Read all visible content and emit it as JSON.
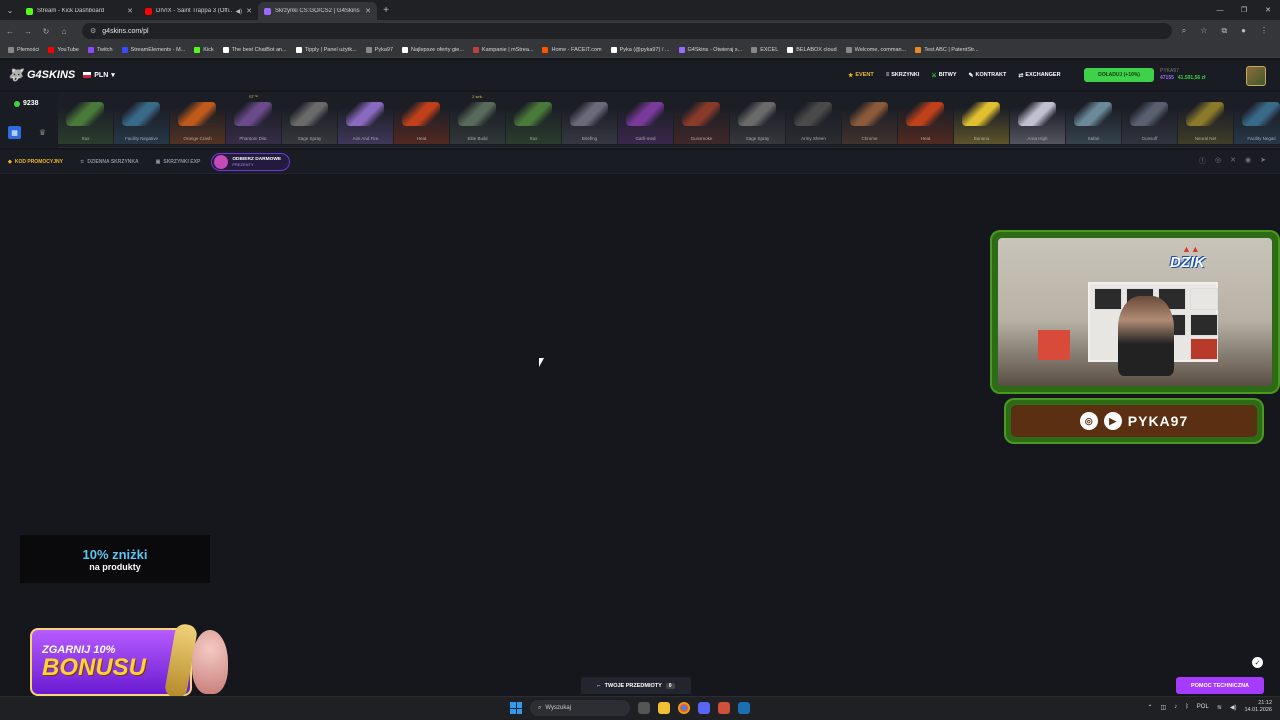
{
  "browser": {
    "tabs": [
      {
        "title": "Stream - Kick Dashboard",
        "icon_color": "#53fc18",
        "active": false
      },
      {
        "title": "DIVIX - Saint Trappa 3 (Offi...",
        "icon_color": "#ff0000",
        "active": false,
        "audio": true
      },
      {
        "title": "Skrzynki CS:GO/CS2 | G4Skins ...",
        "icon_color": "#9b6bff",
        "active": true
      }
    ],
    "new_tab": "+",
    "url": "g4skins.com/pl",
    "bookmarks": [
      {
        "label": "Płemości",
        "color": "#888"
      },
      {
        "label": "YouTube",
        "color": "#ff0000"
      },
      {
        "label": "Twitch",
        "color": "#9146ff"
      },
      {
        "label": "StreamElements - M...",
        "color": "#3a4bff"
      },
      {
        "label": "Kick",
        "color": "#53fc18"
      },
      {
        "label": "The best ChatBot an...",
        "color": "#ffffff"
      },
      {
        "label": "Tipply | Panel użytk...",
        "color": "#ffffff"
      },
      {
        "label": "Pyka97",
        "color": "#888"
      },
      {
        "label": "Najlepsze oferty gie...",
        "color": "#ffffff"
      },
      {
        "label": "Kampanie | mStrea...",
        "color": "#c04040"
      },
      {
        "label": "Home - FACEIT.com",
        "color": "#ff5500"
      },
      {
        "label": "Pyka (@pyka97) / ...",
        "color": "#ffffff"
      },
      {
        "label": "G4Skins - Otwieraj s...",
        "color": "#9b6bff"
      },
      {
        "label": "EXCEL",
        "color": "#888"
      },
      {
        "label": "BELABOX cloud",
        "color": "#ffffff"
      },
      {
        "label": "Welcome, comman...",
        "color": "#888"
      },
      {
        "label": "Test ABC | PatentStr...",
        "color": "#e88a2a"
      }
    ]
  },
  "site": {
    "logo": "G4SKINS",
    "currency": "PLN",
    "nav": [
      {
        "label": "EVENT",
        "icon": "star-icon",
        "glyph": "★"
      },
      {
        "label": "SKRZYNKI",
        "icon": "menu-icon",
        "glyph": "≡"
      },
      {
        "label": "BITWY",
        "icon": "battle-icon",
        "glyph": "⚔"
      },
      {
        "label": "KONTRAKT",
        "icon": "contract-icon",
        "glyph": "✎"
      },
      {
        "label": "EXCHANGER",
        "icon": "exchange-icon",
        "glyph": "⇄"
      }
    ],
    "deposit_label": "DOŁADUJ (+10%)",
    "balance_label": "PYKA97",
    "points": "47155",
    "balance": "41.591,56 zł"
  },
  "feed": {
    "online": "9238",
    "drops": [
      {
        "name": "Sus",
        "color": "#4a7a3a",
        "tag": ""
      },
      {
        "name": "Facility Negative",
        "color": "#3a6a8a",
        "tag": ""
      },
      {
        "name": "Orange Crash",
        "color": "#c05a1a",
        "tag": ""
      },
      {
        "name": "Phantom Disr.",
        "color": "#6a4a8a",
        "tag": "ST™"
      },
      {
        "name": "Sage Spray",
        "color": "#6a6a6a",
        "tag": ""
      },
      {
        "name": "Aim And Fire",
        "color": "#8a6ac0",
        "tag": ""
      },
      {
        "name": "Heat",
        "color": "#c0401a",
        "tag": ""
      },
      {
        "name": "Elite Build",
        "color": "#5a6a5a",
        "tag": "2 sek."
      },
      {
        "name": "Sus",
        "color": "#4a7a3a",
        "tag": ""
      },
      {
        "name": "Briefing",
        "color": "#6a6a7a",
        "tag": ""
      },
      {
        "name": "Garfi-med",
        "color": "#7a3a9a",
        "tag": ""
      },
      {
        "name": "Gunsmoke",
        "color": "#8a3a2a",
        "tag": ""
      },
      {
        "name": "Sage Spray",
        "color": "#6a6a6a",
        "tag": ""
      },
      {
        "name": "Army Sheen",
        "color": "#4a4a4a",
        "tag": ""
      },
      {
        "name": "Chrome",
        "color": "#8a5a3a",
        "tag": ""
      },
      {
        "name": "Heat",
        "color": "#c0401a",
        "tag": ""
      },
      {
        "name": "Banana",
        "color": "#e0c030",
        "tag": ""
      },
      {
        "name": "Area High",
        "color": "#c0c0d0",
        "tag": ""
      },
      {
        "name": "Safari",
        "color": "#6a8a9a",
        "tag": ""
      },
      {
        "name": "Gunsoff",
        "color": "#5a6070",
        "tag": ""
      },
      {
        "name": "Neural Net",
        "color": "#8a7a2a",
        "tag": ""
      },
      {
        "name": "Facility Negati",
        "color": "#3a6a8a",
        "tag": ""
      }
    ]
  },
  "subnav": {
    "promo": "KOD PROMOCYJNY",
    "daily": "DZIENNA SKRZYNKA",
    "exp": "SKRZYNKI EXP",
    "free_title": "ODBIERZ DARMOWE",
    "free_sub": "PREZENTY"
  },
  "overlay": {
    "discount_big": "10% zniżki",
    "discount_small": "na produkty",
    "bonus_line1": "ZGARNIJ 10%",
    "bonus_line2": "BONUSU",
    "webcam_logo": "DZIK",
    "handle": "PYKA97"
  },
  "bottom": {
    "items_label": "TWOJE PRZEDMIOTY",
    "items_count": "0",
    "help_label": "POMOC TECHNICZNA"
  },
  "taskbar": {
    "search_placeholder": "Wyszukaj",
    "lang": "POL",
    "time": "21:12",
    "date": "14.01.2026"
  }
}
